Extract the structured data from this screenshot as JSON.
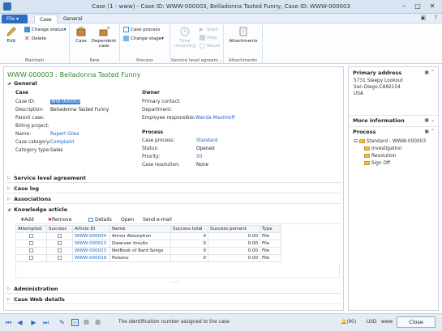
{
  "window": {
    "title": "Case (1 - www) - Case ID: WWW-000003, Belladonna Tasted Funny, Case ID: WWW-000003"
  },
  "tabs": {
    "file": "File",
    "case": "Case",
    "general": "General"
  },
  "ribbon": {
    "maintain": {
      "label": "Maintain",
      "edit": "Edit",
      "change_status": "Change status",
      "delete": "Delete"
    },
    "new": {
      "label": "New",
      "case": "Case",
      "dependent_case": "Dependent case"
    },
    "process": {
      "label": "Process",
      "case_process": "Case process",
      "change_stage": "Change stage"
    },
    "sla": {
      "label": "Service level agreem...",
      "time_recording": "Time recording",
      "start": "Start",
      "stop": "Stop",
      "recall": "Recall"
    },
    "attachments": {
      "label": "Attachments",
      "button": "Attachments"
    }
  },
  "record": {
    "title": "WWW-000003 : Belladonna Tasted Funny"
  },
  "general": {
    "header": "General",
    "case_group": "Case",
    "case_id_label": "Case ID:",
    "case_id": "WW-000003",
    "description_label": "Description:",
    "description": "Belladonna Tasted Funny",
    "parent_case_label": "Parent case:",
    "billing_project_label": "Billing project:",
    "name_label": "Name:",
    "name": "Rupert Giles",
    "category_label": "Case category:",
    "category": "Complaint",
    "category_type_label": "Category type:",
    "category_type": "Sales",
    "owner_group": "Owner",
    "primary_contact_label": "Primary contact:",
    "department_label": "Department:",
    "employee_label": "Employee responsible:",
    "employee": "Wanda Maximoff",
    "process_group": "Process",
    "case_process_label": "Case process:",
    "case_process": "Standard",
    "status_label": "Status:",
    "status": "Opened",
    "priority_label": "Priority:",
    "priority": "50",
    "resolution_label": "Case resolution:",
    "resolution": "None"
  },
  "sections": {
    "sla": "Service level agreement",
    "case_log": "Case log",
    "associations": "Associations",
    "knowledge": "Knowledge article",
    "administration": "Administration",
    "web_details": "Case Web details"
  },
  "knowledge": {
    "add": "Add",
    "remove": "Remove",
    "details": "Details",
    "open": "Open",
    "send_email": "Send e-mail",
    "columns": [
      "Attempted",
      "Success",
      "Article ID",
      "Name",
      "Success total",
      "Success percent",
      "Type"
    ],
    "rows": [
      {
        "article_id": "WWW-000004",
        "name": "Armor Absorption",
        "total": "0",
        "percent": "0.00",
        "type": "File"
      },
      {
        "article_id": "WWW-000013",
        "name": "Dwarven Insults",
        "total": "0",
        "percent": "0.00",
        "type": "File"
      },
      {
        "article_id": "WWW-000023",
        "name": "NetBook of Bard Songs",
        "total": "0",
        "percent": "0.00",
        "type": "File"
      },
      {
        "article_id": "WWW-000029",
        "name": "Poisons",
        "total": "0",
        "percent": "0.00",
        "type": "File"
      }
    ],
    "more": "....."
  },
  "factbox": {
    "address_header": "Primary address",
    "address_line1": "5731 Sleepy Lookout",
    "address_line2": "San Diego,CA92154",
    "address_line3": "USA",
    "more_header": "More information",
    "process_header": "Process",
    "process_root": "Standard - WWW-000003",
    "stages": [
      "Investigation",
      "Resolution",
      "Sign Off"
    ]
  },
  "statusbar": {
    "message": "The identification number assigned to the case",
    "alerts": "(90)",
    "currency": "USD",
    "company": "www",
    "close": "Close"
  },
  "colors": {
    "accent": "#2b6cc4",
    "title_green": "#2d8a2d",
    "link": "#1f64c8"
  }
}
